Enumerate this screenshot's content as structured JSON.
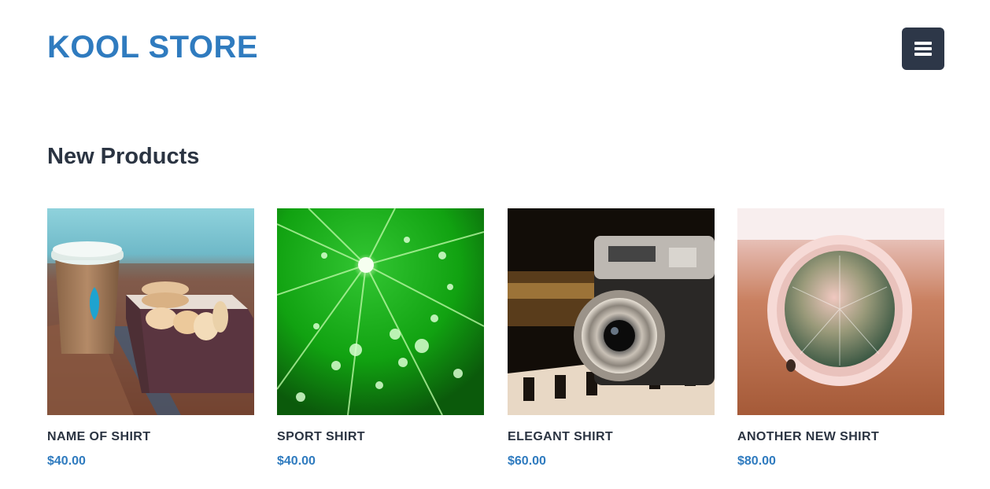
{
  "header": {
    "brand": "KOOL STORE",
    "menu_icon": "hamburger-menu-icon"
  },
  "section": {
    "title": "New Products"
  },
  "products": [
    {
      "name": "NAME OF SHIRT",
      "price": "$40.00",
      "image": "coffee-cup-and-macarons-photo"
    },
    {
      "name": "SPORT SHIRT",
      "price": "$40.00",
      "image": "green-leaf-water-drops-photo"
    },
    {
      "name": "ELEGANT SHIRT",
      "price": "$60.00",
      "image": "vintage-camera-on-piano-photo"
    },
    {
      "name": "ANOTHER NEW SHIRT",
      "price": "$80.00",
      "image": "cactus-in-pot-photo"
    }
  ],
  "colors": {
    "brand": "#2f7bbf",
    "heading": "#2b3442",
    "price": "#2f7bbf",
    "menu_button_bg": "#2d3748"
  }
}
